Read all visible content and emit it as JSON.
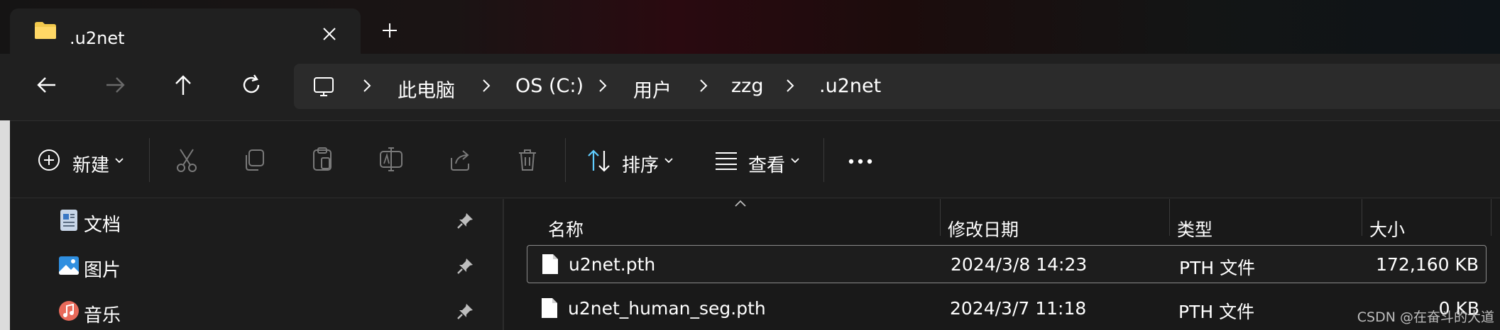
{
  "window": {
    "tab_title": ".u2net",
    "tab_icon": "folder-icon"
  },
  "nav": {
    "back": "back-arrow-icon",
    "forward": "forward-arrow-icon",
    "up": "up-arrow-icon",
    "refresh": "refresh-icon"
  },
  "breadcrumb": {
    "items": [
      "此电脑",
      "OS (C:)",
      "用户",
      "zzg",
      ".u2net"
    ]
  },
  "toolbar": {
    "new_label": "新建",
    "sort_label": "排序",
    "view_label": "查看",
    "more_label": "..."
  },
  "sidebar": {
    "items": [
      {
        "label": "文档",
        "icon": "documents-icon"
      },
      {
        "label": "图片",
        "icon": "pictures-icon"
      },
      {
        "label": "音乐",
        "icon": "music-icon"
      }
    ]
  },
  "table": {
    "columns": [
      "名称",
      "修改日期",
      "类型",
      "大小"
    ],
    "rows": [
      {
        "name": "u2net.pth",
        "modified": "2024/3/8 14:23",
        "type": "PTH 文件",
        "size": "172,160 KB"
      },
      {
        "name": "u2net_human_seg.pth",
        "modified": "2024/3/7 11:18",
        "type": "PTH 文件",
        "size": "0 KB"
      }
    ]
  },
  "watermark": "CSDN @在奋斗的大道",
  "colors": {
    "accent": "#60cdff",
    "folder": "#f2c94c",
    "background": "#1c1c1c"
  }
}
